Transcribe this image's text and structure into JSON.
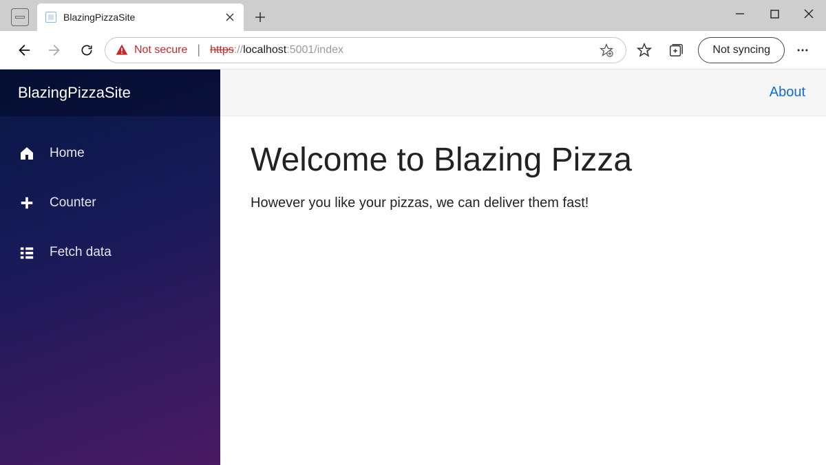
{
  "browser": {
    "tab_title": "BlazingPizzaSite",
    "security_label": "Not secure",
    "url_scheme": "https",
    "url_sep": "://",
    "url_host": "localhost",
    "url_port": ":5001",
    "url_path": "/index",
    "sync_label": "Not syncing"
  },
  "sidebar": {
    "brand": "BlazingPizzaSite",
    "items": [
      {
        "label": "Home"
      },
      {
        "label": "Counter"
      },
      {
        "label": "Fetch data"
      }
    ]
  },
  "topbar": {
    "about": "About"
  },
  "content": {
    "heading": "Welcome to Blazing Pizza",
    "subheading": "However you like your pizzas, we can deliver them fast!"
  }
}
